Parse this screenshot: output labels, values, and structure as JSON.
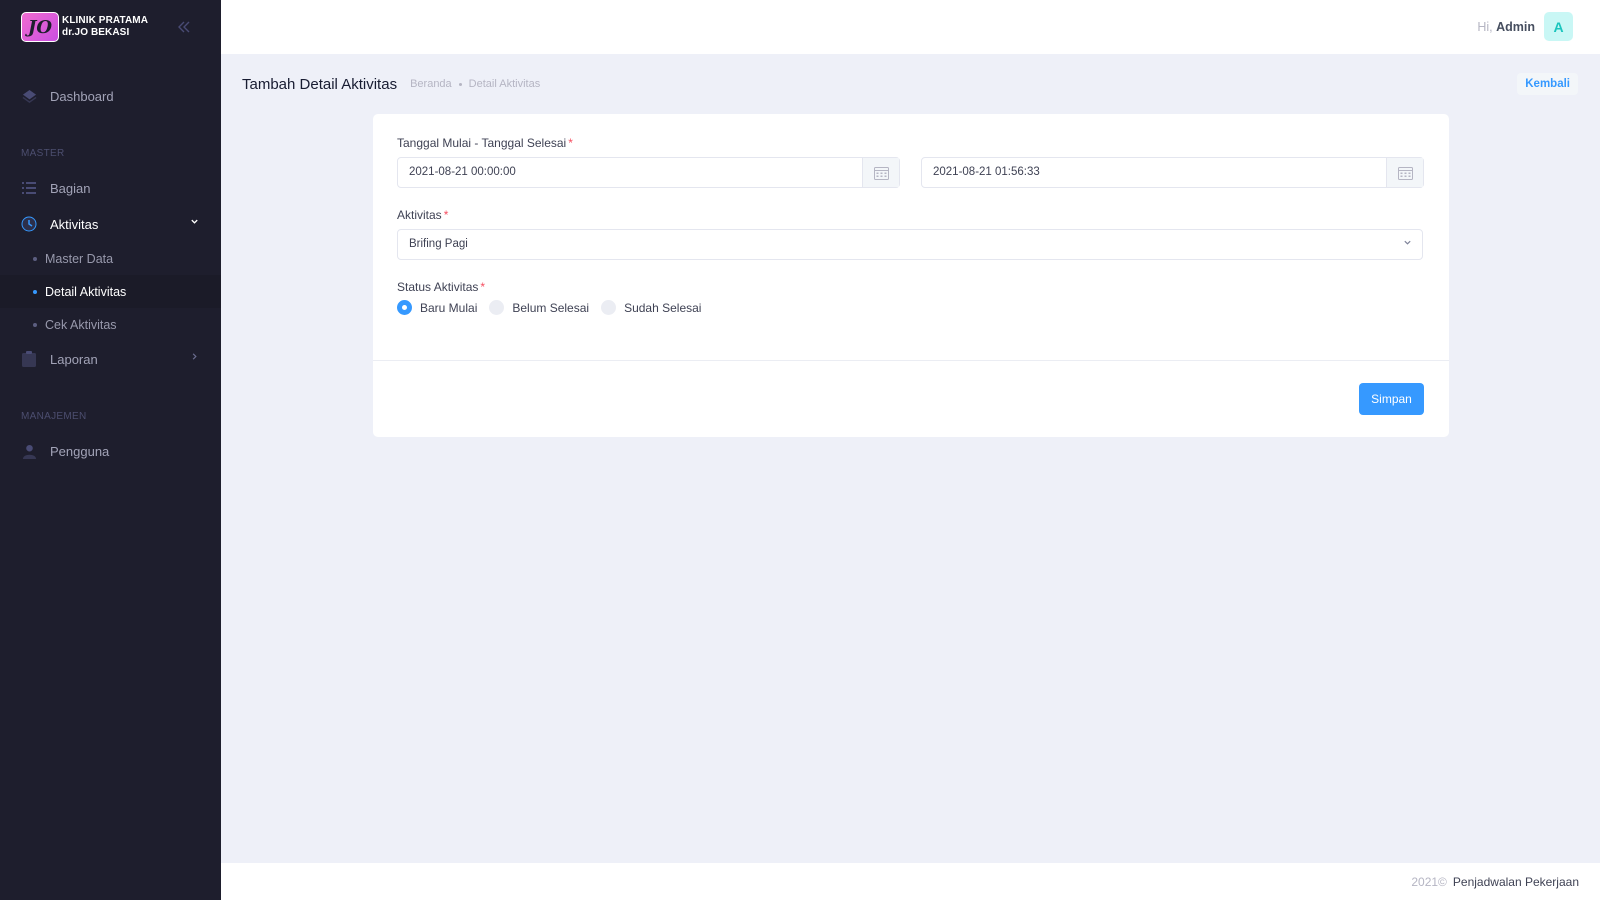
{
  "brand": {
    "logo_text": "JO",
    "name_line1": "KLINIK PRATAMA",
    "name_line2": "dr.JO BEKASI"
  },
  "sidebar": {
    "items": [
      {
        "type": "item",
        "label": "Dashboard",
        "icon": "layers-icon"
      },
      {
        "type": "section",
        "label": "MASTER"
      },
      {
        "type": "item",
        "label": "Bagian",
        "icon": "list-icon"
      },
      {
        "type": "item",
        "label": "Aktivitas",
        "icon": "clock-icon",
        "open": true
      },
      {
        "type": "subitem",
        "label": "Master Data"
      },
      {
        "type": "subitem",
        "label": "Detail Aktivitas",
        "active": true
      },
      {
        "type": "subitem",
        "label": "Cek Aktivitas"
      },
      {
        "type": "item",
        "label": "Laporan",
        "icon": "clipboard-icon"
      },
      {
        "type": "section",
        "label": "MANAJEMEN"
      },
      {
        "type": "item",
        "label": "Pengguna",
        "icon": "user-icon"
      }
    ],
    "m0": "Dashboard",
    "s1": "MASTER",
    "m1": "Bagian",
    "m2": "Aktivitas",
    "sub1": "Master Data",
    "sub2": "Detail Aktivitas",
    "sub3": "Cek Aktivitas",
    "m3": "Laporan",
    "s2": "MANAJEMEN",
    "m4": "Pengguna"
  },
  "header": {
    "greeting": "Hi,",
    "user_name": "Admin",
    "avatar_initial": "A"
  },
  "subheader": {
    "title": "Tambah Detail Aktivitas",
    "breadcrumb": [
      "Beranda",
      "Detail Aktivitas"
    ],
    "back_label": "Kembali"
  },
  "form": {
    "date_label": "Tanggal Mulai - Tanggal Selesai",
    "required_mark": "*",
    "start_date": "2021-08-21 00:00:00",
    "end_date": "2021-08-21 01:56:33",
    "activity_label": "Aktivitas",
    "activity_value": "Brifing Pagi",
    "status_label": "Status Aktivitas",
    "status_options": [
      "Baru Mulai",
      "Belum Selesai",
      "Sudah Selesai"
    ],
    "status_selected": "Baru Mulai",
    "save_label": "Simpan"
  },
  "footer": {
    "year": "2021©",
    "app_name": "Penjadwalan Pekerjaan"
  },
  "colors": {
    "sidebar_bg": "#1e1e2d",
    "primary": "#3699ff",
    "required": "#f64e60",
    "avatar_bg": "#c9f7f5",
    "avatar_text": "#1bc5bd"
  }
}
